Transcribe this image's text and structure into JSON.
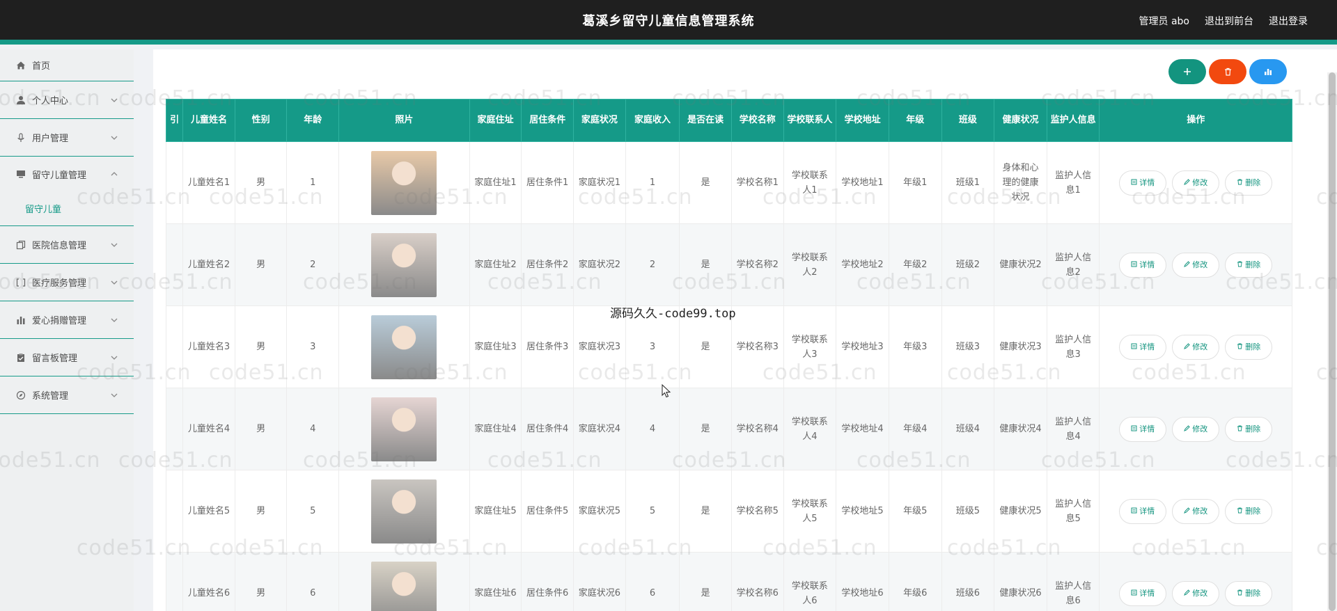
{
  "header": {
    "title": "葛溪乡留守儿童信息管理系统",
    "admin_label": "管理员 abo",
    "exit_front": "退出到前台",
    "logout": "退出登录"
  },
  "sidebar": {
    "items": [
      {
        "label": "首页",
        "icon": "home-icon"
      },
      {
        "label": "个人中心",
        "icon": "user-icon"
      },
      {
        "label": "用户管理",
        "icon": "mic-icon"
      },
      {
        "label": "留守儿童管理",
        "icon": "monitor-icon",
        "expanded": true
      },
      {
        "label": "医院信息管理",
        "icon": "copy-icon"
      },
      {
        "label": "医疗服务管理",
        "icon": "bracket-icon"
      },
      {
        "label": "爱心捐赠管理",
        "icon": "bar-chart-icon"
      },
      {
        "label": "留言板管理",
        "icon": "clipboard-icon"
      },
      {
        "label": "系统管理",
        "icon": "compass-icon"
      }
    ],
    "submenu_label": "留守儿童"
  },
  "toolbar": {
    "add_icon": "plus-icon",
    "delete_icon": "trash-icon",
    "stat_icon": "chart-icon",
    "colors": {
      "add": "#13947f",
      "delete": "#f2490f",
      "stat": "#2898f0"
    }
  },
  "table": {
    "headers": [
      "引",
      "儿童姓名",
      "性别",
      "年龄",
      "照片",
      "家庭住址",
      "居住条件",
      "家庭状况",
      "家庭收入",
      "是否在读",
      "学校名称",
      "学校联系人",
      "学校地址",
      "年级",
      "班级",
      "健康状况",
      "监护人信息",
      "操作"
    ],
    "rows": [
      {
        "name": "儿童姓名1",
        "sex": "男",
        "age": "1",
        "addr": "家庭住址1",
        "cond": "居住条件1",
        "status": "家庭状况1",
        "income": "1",
        "reading": "是",
        "school": "学校名称1",
        "contact": "学校联系人1",
        "school_addr": "学校地址1",
        "grade": "年级1",
        "class": "班级1",
        "health": "身体和心理的健康状况",
        "guardian": "监护人信息1",
        "photo_color": "#e8c9a8"
      },
      {
        "name": "儿童姓名2",
        "sex": "男",
        "age": "2",
        "addr": "家庭住址2",
        "cond": "居住条件2",
        "status": "家庭状况2",
        "income": "2",
        "reading": "是",
        "school": "学校名称2",
        "contact": "学校联系人2",
        "school_addr": "学校地址2",
        "grade": "年级2",
        "class": "班级2",
        "health": "健康状况2",
        "guardian": "监护人信息2",
        "photo_color": "#d9cfc8"
      },
      {
        "name": "儿童姓名3",
        "sex": "男",
        "age": "3",
        "addr": "家庭住址3",
        "cond": "居住条件3",
        "status": "家庭状况3",
        "income": "3",
        "reading": "是",
        "school": "学校名称3",
        "contact": "学校联系人3",
        "school_addr": "学校地址3",
        "grade": "年级3",
        "class": "班级3",
        "health": "健康状况3",
        "guardian": "监护人信息3",
        "photo_color": "#b9ccd9"
      },
      {
        "name": "儿童姓名4",
        "sex": "男",
        "age": "4",
        "addr": "家庭住址4",
        "cond": "居住条件4",
        "status": "家庭状况4",
        "income": "4",
        "reading": "是",
        "school": "学校名称4",
        "contact": "学校联系人4",
        "school_addr": "学校地址4",
        "grade": "年级4",
        "class": "班级4",
        "health": "健康状况4",
        "guardian": "监护人信息4",
        "photo_color": "#e6d5d3"
      },
      {
        "name": "儿童姓名5",
        "sex": "男",
        "age": "5",
        "addr": "家庭住址5",
        "cond": "居住条件5",
        "status": "家庭状况5",
        "income": "5",
        "reading": "是",
        "school": "学校名称5",
        "contact": "学校联系人5",
        "school_addr": "学校地址5",
        "grade": "年级5",
        "class": "班级5",
        "health": "健康状况5",
        "guardian": "监护人信息5",
        "photo_color": "#c9c5c0"
      },
      {
        "name": "儿童姓名6",
        "sex": "男",
        "age": "6",
        "addr": "家庭住址6",
        "cond": "居住条件6",
        "status": "家庭状况6",
        "income": "6",
        "reading": "是",
        "school": "学校名称6",
        "contact": "学校联系人6",
        "school_addr": "学校地址6",
        "grade": "年级6",
        "class": "班级6",
        "health": "健康状况6",
        "guardian": "监护人信息6",
        "photo_color": "#d8d2c6"
      }
    ],
    "op_labels": {
      "detail": "详情",
      "edit": "修改",
      "delete": "删除"
    },
    "header_color": "#159a88"
  },
  "watermark": {
    "text": "code51.cn",
    "center_text": "源码久久-code99.top"
  }
}
